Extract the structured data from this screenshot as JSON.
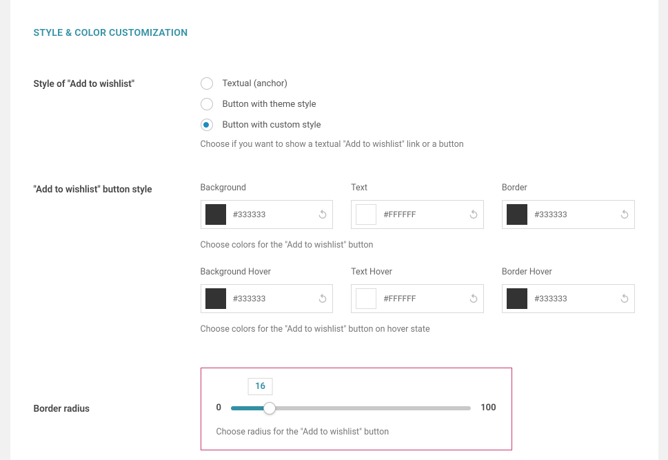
{
  "section_title": "STYLE & COLOR CUSTOMIZATION",
  "style_row": {
    "label": "Style of \"Add to wishlist\"",
    "options": [
      {
        "label": "Textual (anchor)",
        "selected": false
      },
      {
        "label": "Button with theme style",
        "selected": false
      },
      {
        "label": "Button with custom style",
        "selected": true
      }
    ],
    "helper": "Choose if you want to show a textual \"Add to wishlist\" link or a button"
  },
  "button_style_row": {
    "label": "\"Add to wishlist\" button style",
    "normal": [
      {
        "caption": "Background",
        "hex": "#333333",
        "swatch": "#333333"
      },
      {
        "caption": "Text",
        "hex": "#FFFFFF",
        "swatch": "#FFFFFF"
      },
      {
        "caption": "Border",
        "hex": "#333333",
        "swatch": "#333333"
      }
    ],
    "normal_helper": "Choose colors for the \"Add to wishlist\" button",
    "hover": [
      {
        "caption": "Background Hover",
        "hex": "#333333",
        "swatch": "#333333"
      },
      {
        "caption": "Text Hover",
        "hex": "#FFFFFF",
        "swatch": "#FFFFFF"
      },
      {
        "caption": "Border Hover",
        "hex": "#333333",
        "swatch": "#333333"
      }
    ],
    "hover_helper": "Choose colors for the \"Add to wishlist\" button on hover state"
  },
  "radius_row": {
    "label": "Border radius",
    "value": "16",
    "min": "0",
    "max": "100",
    "helper": "Choose radius for the \"Add to wishlist\" button"
  }
}
